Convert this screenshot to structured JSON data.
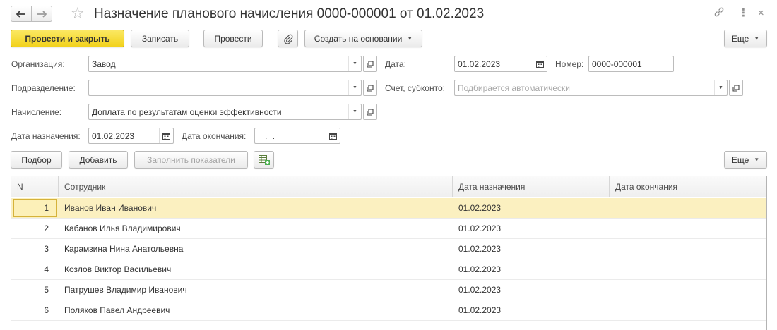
{
  "window": {
    "title": "Назначение планового начисления 0000-000001 от 01.02.2023"
  },
  "toolbar": {
    "post_and_close": "Провести и закрыть",
    "save": "Записать",
    "post": "Провести",
    "create_based_on": "Создать на основании",
    "more": "Еще"
  },
  "form": {
    "organization_label": "Организация:",
    "organization_value": "Завод",
    "date_label": "Дата:",
    "date_value": "01.02.2023",
    "number_label": "Номер:",
    "number_value": "0000-000001",
    "department_label": "Подразделение:",
    "department_value": "",
    "account_label": "Счет, субконто:",
    "account_placeholder": "Подбирается автоматически",
    "accrual_label": "Начисление:",
    "accrual_value": "Доплата по результатам оценки эффективности",
    "assign_date_label": "Дата назначения:",
    "assign_date_value": "01.02.2023",
    "end_date_label": "Дата окончания:",
    "end_date_value": " .  ."
  },
  "table_toolbar": {
    "pick": "Подбор",
    "add": "Добавить",
    "fill_indicators": "Заполнить показатели",
    "more": "Еще"
  },
  "table": {
    "columns": [
      "N",
      "Сотрудник",
      "Дата назначения",
      "Дата окончания"
    ],
    "rows": [
      {
        "n": "1",
        "employee": "Иванов Иван Иванович",
        "assign_date": "01.02.2023",
        "end_date": ""
      },
      {
        "n": "2",
        "employee": "Кабанов Илья Владимирович",
        "assign_date": "01.02.2023",
        "end_date": ""
      },
      {
        "n": "3",
        "employee": "Карамзина Нина Анатольевна",
        "assign_date": "01.02.2023",
        "end_date": ""
      },
      {
        "n": "4",
        "employee": "Козлов Виктор Васильевич",
        "assign_date": "01.02.2023",
        "end_date": ""
      },
      {
        "n": "5",
        "employee": "Патрушев Владимир Иванович",
        "assign_date": "01.02.2023",
        "end_date": ""
      },
      {
        "n": "6",
        "employee": "Поляков Павел Андреевич",
        "assign_date": "01.02.2023",
        "end_date": ""
      }
    ]
  },
  "colors": {
    "primary_button": "#f2d21c",
    "selected_row": "#fbf0c0"
  }
}
